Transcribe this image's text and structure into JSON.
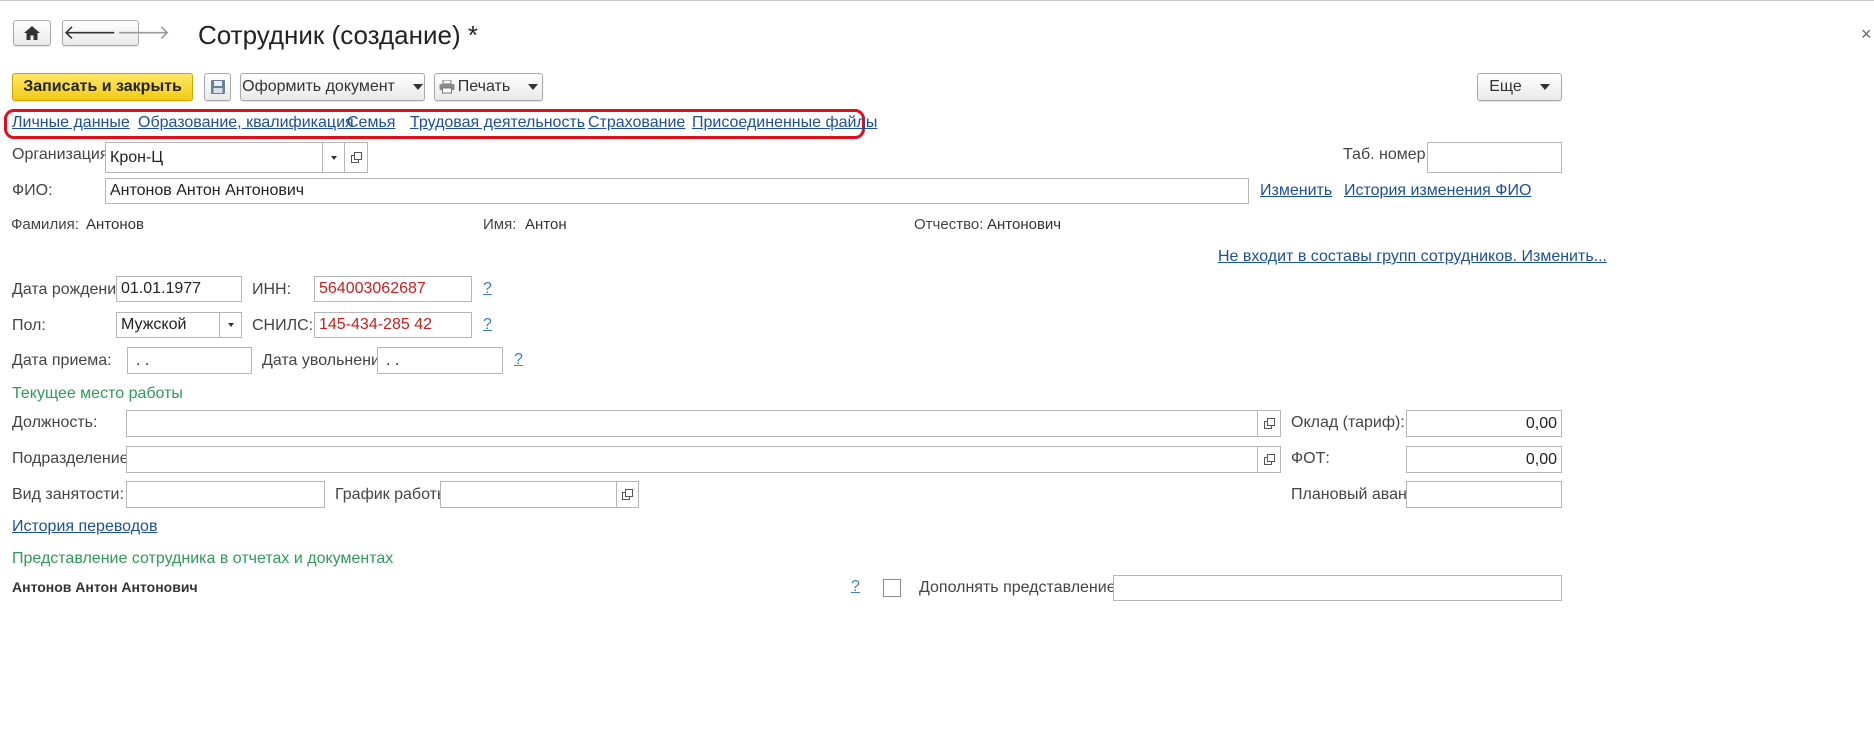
{
  "window": {
    "title": "Сотрудник (создание) *"
  },
  "toolbar": {
    "save_close": "Записать и закрыть",
    "issue_document": "Оформить документ",
    "print": "Печать",
    "more": "Еще"
  },
  "tabs": [
    {
      "label": "Личные данные"
    },
    {
      "label": "Образование, квалификация"
    },
    {
      "label": "Семья"
    },
    {
      "label": "Трудовая деятельность"
    },
    {
      "label": "Страхование"
    },
    {
      "label": "Присоединенные файлы"
    }
  ],
  "form": {
    "organization": {
      "label": "Организация:",
      "value": "Крон-Ц"
    },
    "tab_number": {
      "label": "Таб. номер:",
      "value": ""
    },
    "fio": {
      "label": "ФИО:",
      "value": "Антонов Антон Антонович"
    },
    "fio_change_link": "Изменить",
    "fio_history_link": "История изменения ФИО",
    "last_name": {
      "label": "Фамилия:",
      "value": "Антонов"
    },
    "first_name": {
      "label": "Имя:",
      "value": "Антон"
    },
    "patronymic": {
      "label": "Отчество:",
      "value": "Антонович"
    },
    "groups_link": "Не входит в составы групп сотрудников. Изменить...",
    "birth_date": {
      "label": "Дата рождения:",
      "value": "01.01.1977"
    },
    "inn": {
      "label": "ИНН:",
      "value": "564003062687"
    },
    "gender": {
      "label": "Пол:",
      "value": "Мужской"
    },
    "snils": {
      "label": "СНИЛС:",
      "value": "145-434-285 42"
    },
    "hire_date": {
      "label": "Дата приема:",
      "value": " .  ."
    },
    "dismissal_date": {
      "label": "Дата увольнения:",
      "value": " .  ."
    },
    "help_mark": "?"
  },
  "current_job": {
    "section_title": "Текущее место работы",
    "position": {
      "label": "Должность:",
      "value": ""
    },
    "salary": {
      "label": "Оклад (тариф):",
      "value": "0,00"
    },
    "department": {
      "label": "Подразделение:",
      "value": ""
    },
    "fot": {
      "label": "ФОТ:",
      "value": "0,00"
    },
    "employment_type": {
      "label": "Вид занятости:",
      "value": ""
    },
    "schedule": {
      "label": "График работы:",
      "value": ""
    },
    "planned_advance": {
      "label": "Плановый аванс:",
      "value": ""
    },
    "transfer_history_link": "История переводов"
  },
  "representation": {
    "section_title": "Представление сотрудника в отчетах и документах",
    "name": "Антонов Антон Антонович",
    "supplement_label": "Дополнять представление",
    "supplement_value": ""
  },
  "colors": {
    "accent_button": "#f2cb12",
    "link": "#1c4f9c",
    "section": "#2f9a5a",
    "highlight": "#e00d1b",
    "error_text": "#c8201e"
  }
}
